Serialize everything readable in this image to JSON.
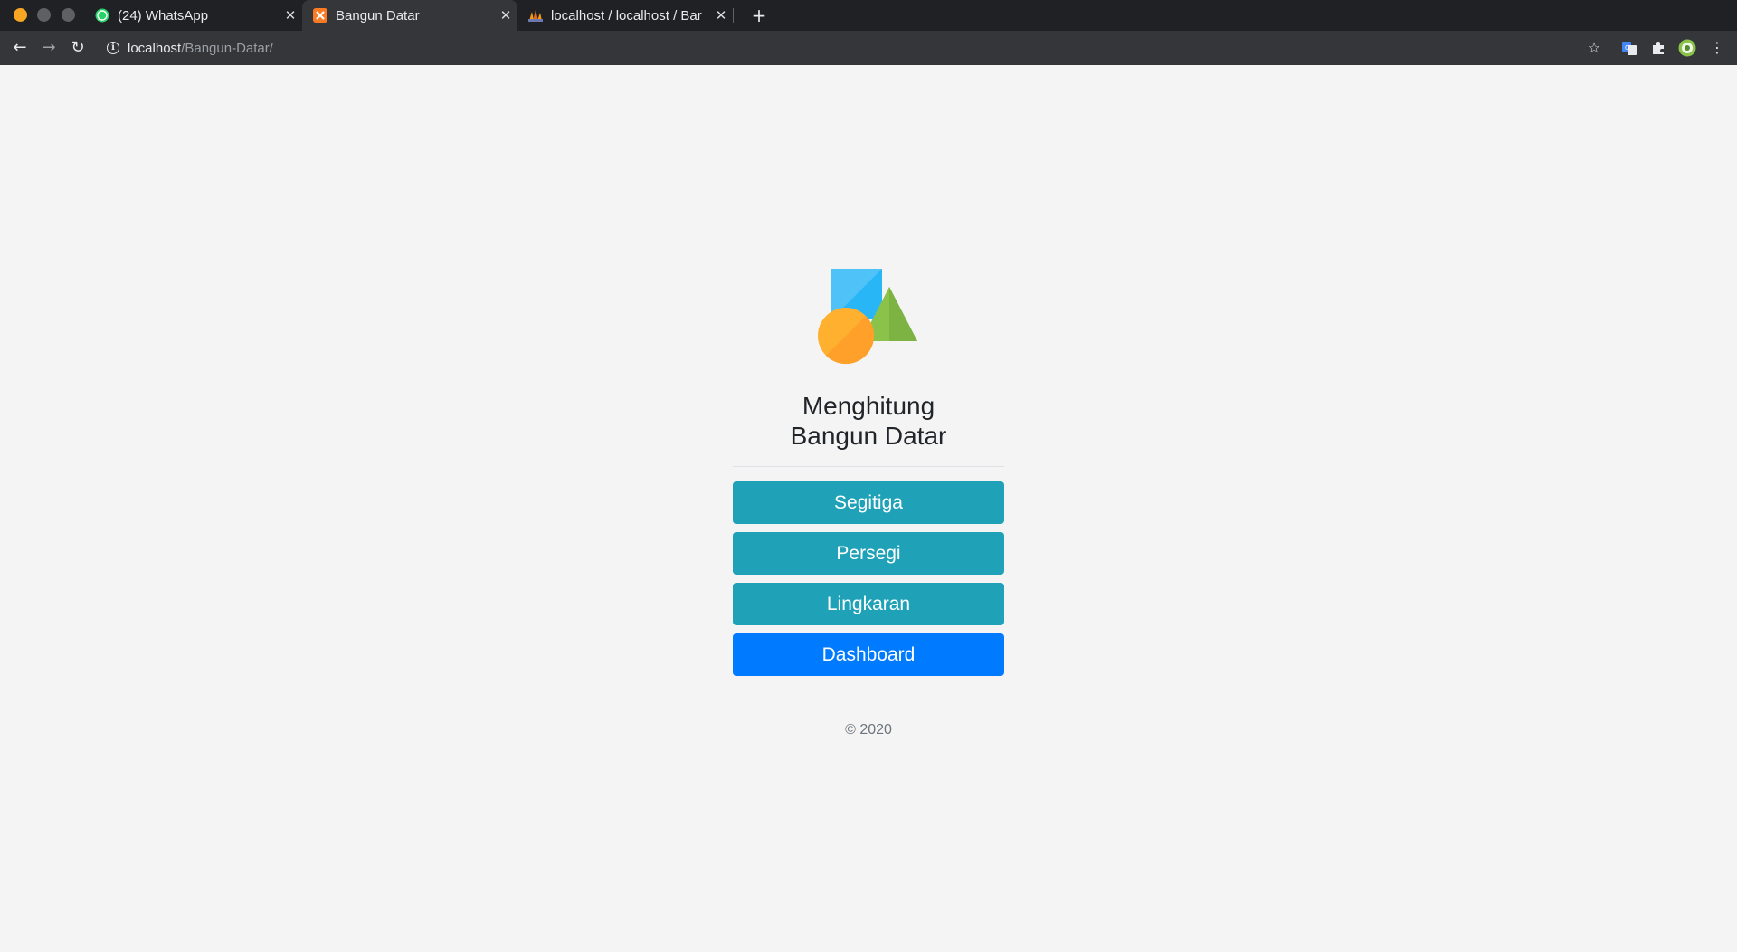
{
  "browser": {
    "tabs": [
      {
        "title": "(24) WhatsApp",
        "favicon": "whatsapp-icon",
        "active": false
      },
      {
        "title": "Bangun Datar",
        "favicon": "xampp-icon",
        "active": true
      },
      {
        "title": "localhost / localhost / Bar",
        "favicon": "phpmyadmin-icon",
        "active": false
      }
    ],
    "url": {
      "host": "localhost",
      "path": "/Bangun-Datar/"
    }
  },
  "main": {
    "logo": "shapes-logo",
    "heading_line1": "Menghitung",
    "heading_line2": "Bangun Datar",
    "buttons": [
      {
        "label": "Segitiga",
        "style": "info"
      },
      {
        "label": "Persegi",
        "style": "info"
      },
      {
        "label": "Lingkaran",
        "style": "info"
      },
      {
        "label": "Dashboard",
        "style": "primary"
      }
    ],
    "footer": "© 2020"
  },
  "colors": {
    "info_button": "#1fa2b7",
    "primary_button": "#007bff",
    "page_background": "#f4f4f4"
  }
}
